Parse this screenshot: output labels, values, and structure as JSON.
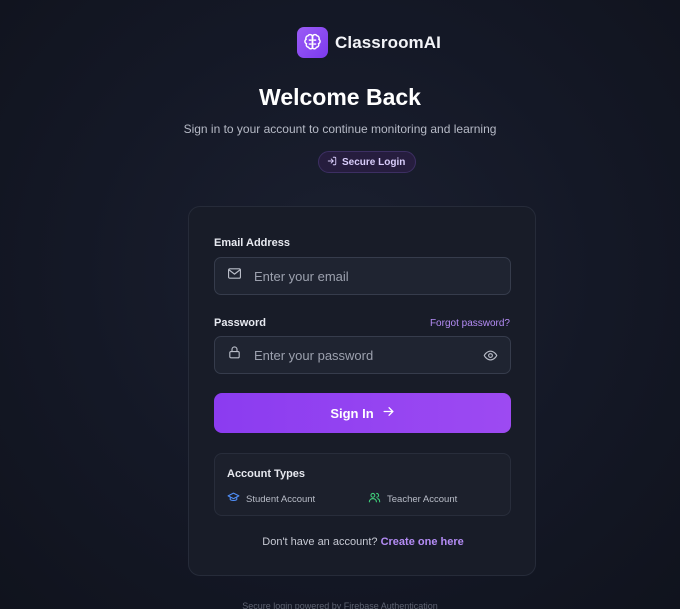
{
  "brand": {
    "name": "ClassroomAI",
    "icon": "brain-icon",
    "accent": "#8b3cf0"
  },
  "header": {
    "title": "Welcome Back",
    "subtitle": "Sign in to your account to continue monitoring and learning",
    "badge": "Secure Login",
    "badge_icon": "login-icon"
  },
  "form": {
    "email": {
      "label": "Email Address",
      "placeholder": "Enter your email",
      "value": "",
      "icon": "mail-icon"
    },
    "password": {
      "label": "Password",
      "placeholder": "Enter your password",
      "value": "",
      "icon": "lock-icon",
      "toggle_icon": "eye-icon"
    },
    "forgot_label": "Forgot password?",
    "submit_label": "Sign In",
    "submit_icon": "arrow-right-icon"
  },
  "account_types": {
    "title": "Account Types",
    "items": [
      {
        "label": "Student Account",
        "icon": "graduation-cap-icon",
        "color": "#4f8ef7"
      },
      {
        "label": "Teacher Account",
        "icon": "users-icon",
        "color": "#3ecf7a"
      }
    ]
  },
  "signup": {
    "prompt": "Don't have an account?",
    "link_label": "Create one here"
  },
  "footer": {
    "text": "Secure login powered by Firebase Authentication"
  }
}
